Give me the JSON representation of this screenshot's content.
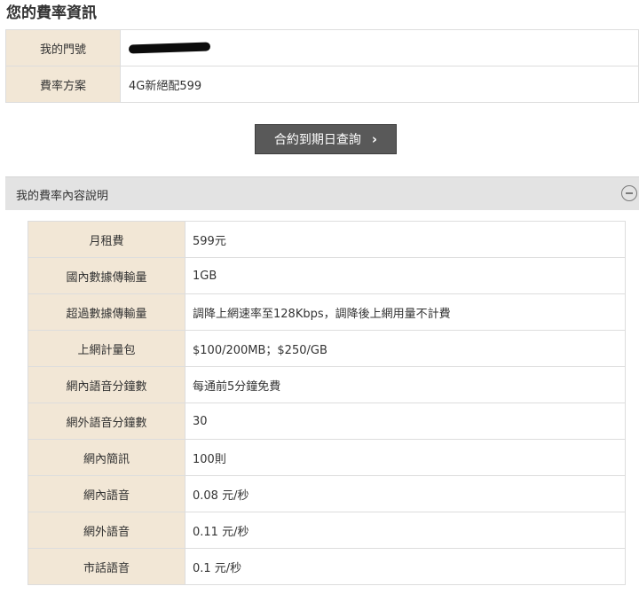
{
  "page_title": "您的費率資訊",
  "info": {
    "phone_label": "我的門號",
    "plan_label": "費率方案",
    "plan_value": "4G新絕配599"
  },
  "contract_button": {
    "label": "合約到期日查詢",
    "icon": "chevron-right-icon"
  },
  "section": {
    "title": "我的費率內容說明",
    "toggle_icon": "minus-circle-icon"
  },
  "details": [
    {
      "label": "月租費",
      "value": "599元"
    },
    {
      "label": "國內數據傳輸量",
      "value": "1GB"
    },
    {
      "label": "超過數據傳輸量",
      "value": "調降上網速率至128Kbps，調降後上網用量不計費"
    },
    {
      "label": "上網計量包",
      "value": "$100/200MB；$250/GB"
    },
    {
      "label": "網內語音分鐘數",
      "value": "每通前5分鐘免費"
    },
    {
      "label": "網外語音分鐘數",
      "value": "30"
    },
    {
      "label": "網內簡訊",
      "value": "100則"
    },
    {
      "label": "網內語音",
      "value": "0.08 元/秒"
    },
    {
      "label": "網外語音",
      "value": "0.11 元/秒"
    },
    {
      "label": "市話語音",
      "value": "0.1 元/秒"
    }
  ]
}
